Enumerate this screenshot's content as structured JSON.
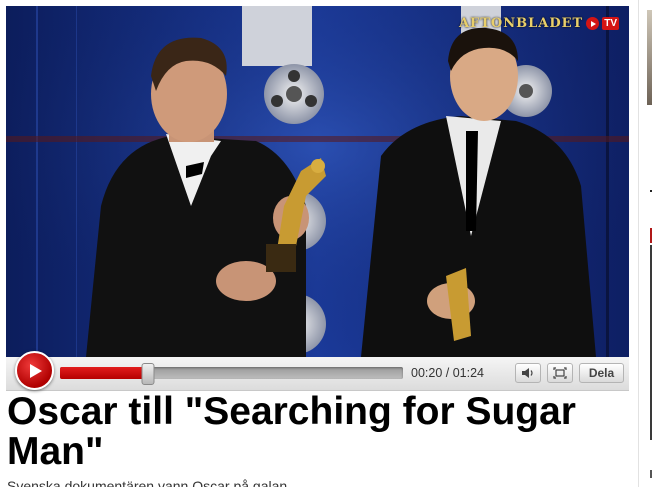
{
  "watermark": {
    "brand": "AFTONBLADET",
    "tv_label": "TV"
  },
  "player": {
    "current_time": "00:20",
    "duration": "01:24",
    "time_separator": " / ",
    "progress_fraction": 0.24,
    "share_label": "Dela",
    "icons": {
      "play": "play-icon",
      "volume": "speaker-icon",
      "fullscreen": "fullscreen-icon"
    },
    "colors": {
      "accent": "#d41414",
      "track": "#b0b0b0"
    }
  },
  "article": {
    "headline": "Oscar till \"Searching for Sugar Man\"",
    "subline": "Svenska dokumentären vann Oscar på galan"
  }
}
